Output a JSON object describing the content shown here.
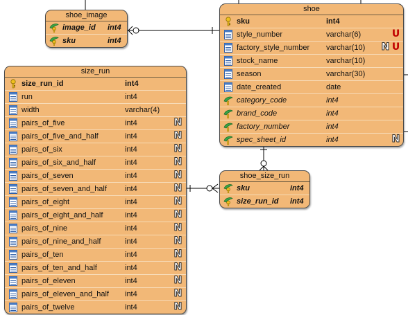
{
  "tables": {
    "shoe_image": {
      "title": "shoe_image",
      "columns": [
        {
          "name": "image_id",
          "type": "int4",
          "kind": "pkfk",
          "icon": "key-leaf-icon",
          "badges": []
        },
        {
          "name": "sku",
          "type": "int4",
          "kind": "pkfk",
          "icon": "key-leaf-icon",
          "badges": []
        }
      ]
    },
    "shoe": {
      "title": "shoe",
      "columns": [
        {
          "name": "sku",
          "type": "int4",
          "kind": "pk",
          "icon": "key-icon",
          "badges": []
        },
        {
          "name": "style_number",
          "type": "varchar(6)",
          "kind": "col",
          "icon": "column-icon",
          "badges": [
            "U"
          ]
        },
        {
          "name": "factory_style_number",
          "type": "varchar(10)",
          "kind": "col",
          "icon": "column-icon",
          "badges": [
            "N",
            "U"
          ]
        },
        {
          "name": "stock_name",
          "type": "varchar(10)",
          "kind": "col",
          "icon": "column-icon",
          "badges": []
        },
        {
          "name": "season",
          "type": "varchar(30)",
          "kind": "col",
          "icon": "column-icon",
          "badges": []
        },
        {
          "name": "date_created",
          "type": "date",
          "kind": "col",
          "icon": "column-icon",
          "badges": []
        },
        {
          "name": "category_code",
          "type": "int4",
          "kind": "fk",
          "icon": "leaf-icon",
          "badges": []
        },
        {
          "name": "brand_code",
          "type": "int4",
          "kind": "fk",
          "icon": "leaf-icon",
          "badges": []
        },
        {
          "name": "factory_number",
          "type": "int4",
          "kind": "fk",
          "icon": "leaf-icon",
          "badges": []
        },
        {
          "name": "spec_sheet_id",
          "type": "int4",
          "kind": "fk",
          "icon": "leaf-icon",
          "badges": [
            "N"
          ]
        }
      ]
    },
    "size_run": {
      "title": "size_run",
      "columns": [
        {
          "name": "size_run_id",
          "type": "int4",
          "kind": "pk",
          "icon": "key-icon",
          "badges": []
        },
        {
          "name": "run",
          "type": "int4",
          "kind": "col",
          "icon": "column-icon",
          "badges": []
        },
        {
          "name": "width",
          "type": "varchar(4)",
          "kind": "col",
          "icon": "column-icon",
          "badges": []
        },
        {
          "name": "pairs_of_five",
          "type": "int4",
          "kind": "col",
          "icon": "column-icon",
          "badges": [
            "N"
          ]
        },
        {
          "name": "pairs_of_five_and_half",
          "type": "int4",
          "kind": "col",
          "icon": "column-icon",
          "badges": [
            "N"
          ]
        },
        {
          "name": "pairs_of_six",
          "type": "int4",
          "kind": "col",
          "icon": "column-icon",
          "badges": [
            "N"
          ]
        },
        {
          "name": "pairs_of_six_and_half",
          "type": "int4",
          "kind": "col",
          "icon": "column-icon",
          "badges": [
            "N"
          ]
        },
        {
          "name": "pairs_of_seven",
          "type": "int4",
          "kind": "col",
          "icon": "column-icon",
          "badges": [
            "N"
          ]
        },
        {
          "name": "pairs_of_seven_and_half",
          "type": "int4",
          "kind": "col",
          "icon": "column-icon",
          "badges": [
            "N"
          ]
        },
        {
          "name": "pairs_of_eight",
          "type": "int4",
          "kind": "col",
          "icon": "column-icon",
          "badges": [
            "N"
          ]
        },
        {
          "name": "pairs_of_eight_and_half",
          "type": "int4",
          "kind": "col",
          "icon": "column-icon",
          "badges": [
            "N"
          ]
        },
        {
          "name": "pairs_of_nine",
          "type": "int4",
          "kind": "col",
          "icon": "column-icon",
          "badges": [
            "N"
          ]
        },
        {
          "name": "pairs_of_nine_and_half",
          "type": "int4",
          "kind": "col",
          "icon": "column-icon",
          "badges": [
            "N"
          ]
        },
        {
          "name": "pairs_of_ten",
          "type": "int4",
          "kind": "col",
          "icon": "column-icon",
          "badges": [
            "N"
          ]
        },
        {
          "name": "pairs_of_ten_and_half",
          "type": "int4",
          "kind": "col",
          "icon": "column-icon",
          "badges": [
            "N"
          ]
        },
        {
          "name": "pairs_of_eleven",
          "type": "int4",
          "kind": "col",
          "icon": "column-icon",
          "badges": [
            "N"
          ]
        },
        {
          "name": "pairs_of_eleven_and_half",
          "type": "int4",
          "kind": "col",
          "icon": "column-icon",
          "badges": [
            "N"
          ]
        },
        {
          "name": "pairs_of_twelve",
          "type": "int4",
          "kind": "col",
          "icon": "column-icon",
          "badges": [
            "N"
          ]
        }
      ]
    },
    "shoe_size_run": {
      "title": "shoe_size_run",
      "columns": [
        {
          "name": "sku",
          "type": "int4",
          "kind": "pkfk",
          "icon": "key-leaf-icon",
          "badges": []
        },
        {
          "name": "size_run_id",
          "type": "int4",
          "kind": "pkfk",
          "icon": "key-leaf-icon",
          "badges": []
        }
      ]
    }
  },
  "colors": {
    "table_fill": "#f2b877",
    "unique_badge": "#c00000",
    "line": "#000000"
  }
}
